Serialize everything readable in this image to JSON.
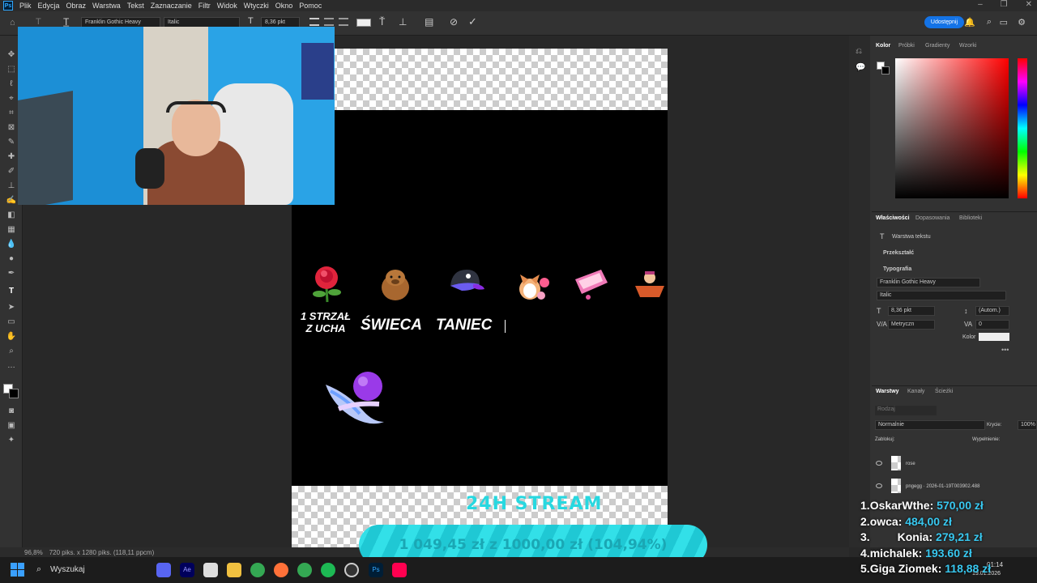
{
  "menu": [
    "Plik",
    "Edycja",
    "Obraz",
    "Warstwa",
    "Tekst",
    "Zaznaczanie",
    "Filtr",
    "Widok",
    "Wtyczki",
    "Okno",
    "Pomoc"
  ],
  "options_bar": {
    "font_family": "Franklin Gothic Heavy",
    "font_style": "Italic",
    "font_size": "8,36 pkt",
    "share_label": "Udostępnij"
  },
  "canvas": {
    "caption_1": "1 STRZAŁ\nZ UCHA",
    "caption_2": "ŚWIECA",
    "caption_3": "TANIEC"
  },
  "icons": [
    "move-icon",
    "marquee-icon",
    "lasso-icon",
    "crop-icon",
    "eyedropper-icon",
    "brush-icon",
    "stamp-icon",
    "eraser-icon",
    "gradient-icon",
    "pen-icon",
    "type-icon",
    "hand-icon",
    "zoom-icon"
  ],
  "color_panel": {
    "tabs": [
      "Kolor",
      "Próbki",
      "Gradienty",
      "Wzorki"
    ]
  },
  "properties_panel": {
    "tabs": [
      "Właściwości",
      "Dopasowania",
      "Biblioteki"
    ],
    "layer_type": "Warstwa tekstu",
    "transform_label": "Przekształć",
    "typography_label": "Typografia",
    "font_family": "Franklin Gothic Heavy",
    "font_style": "Italic",
    "font_size": "8,36 pkt",
    "leading": "(Autom.)",
    "kerning": "Metryczn",
    "tracking": "0",
    "color_label": "Kolor"
  },
  "layers_panel": {
    "tabs": [
      "Warstwy",
      "Kanały",
      "Ścieżki"
    ],
    "search_placeholder": "Rodzaj",
    "blend_mode": "Normalnie",
    "opacity_label": "Krycie:",
    "opacity_value": "100%",
    "lock_label": "Zablokuj:",
    "fill_label": "Wypełnienie:",
    "layers": [
      {
        "name": "rose"
      },
      {
        "name": "pngegg · 2026-01-19T003902.488"
      }
    ]
  },
  "statusbar": {
    "zoom": "96,8%",
    "doc_info": "720 piks. x 1280 piks. (118,11 ppcm)"
  },
  "overlay": {
    "stream_title": "24H STREAM",
    "goal_text": "1 049,45 zł z 1000,00 zł (104,94%)",
    "goal_progress": 1.0494,
    "leaderboard": [
      {
        "rank": "1.",
        "name": "OskarWthe:",
        "amount": "570,00 zł"
      },
      {
        "rank": "2.",
        "name": "owca:",
        "amount": "484,00 zł"
      },
      {
        "rank": "3.",
        "name": "Konia:",
        "amount": "279,21 zł"
      },
      {
        "rank": "4.",
        "name": "michalek:",
        "amount": "193,60 zł"
      },
      {
        "rank": "5.",
        "name": "Giga Ziomek:",
        "amount": "118,88 zł"
      }
    ]
  },
  "taskbar": {
    "search_label": "Wyszukaj",
    "time": "01:14",
    "date": "19.01.2026"
  },
  "colors": {
    "accent": "#1473e6",
    "overlay_cyan": "#28d8e0",
    "panel_bg": "#323232"
  }
}
